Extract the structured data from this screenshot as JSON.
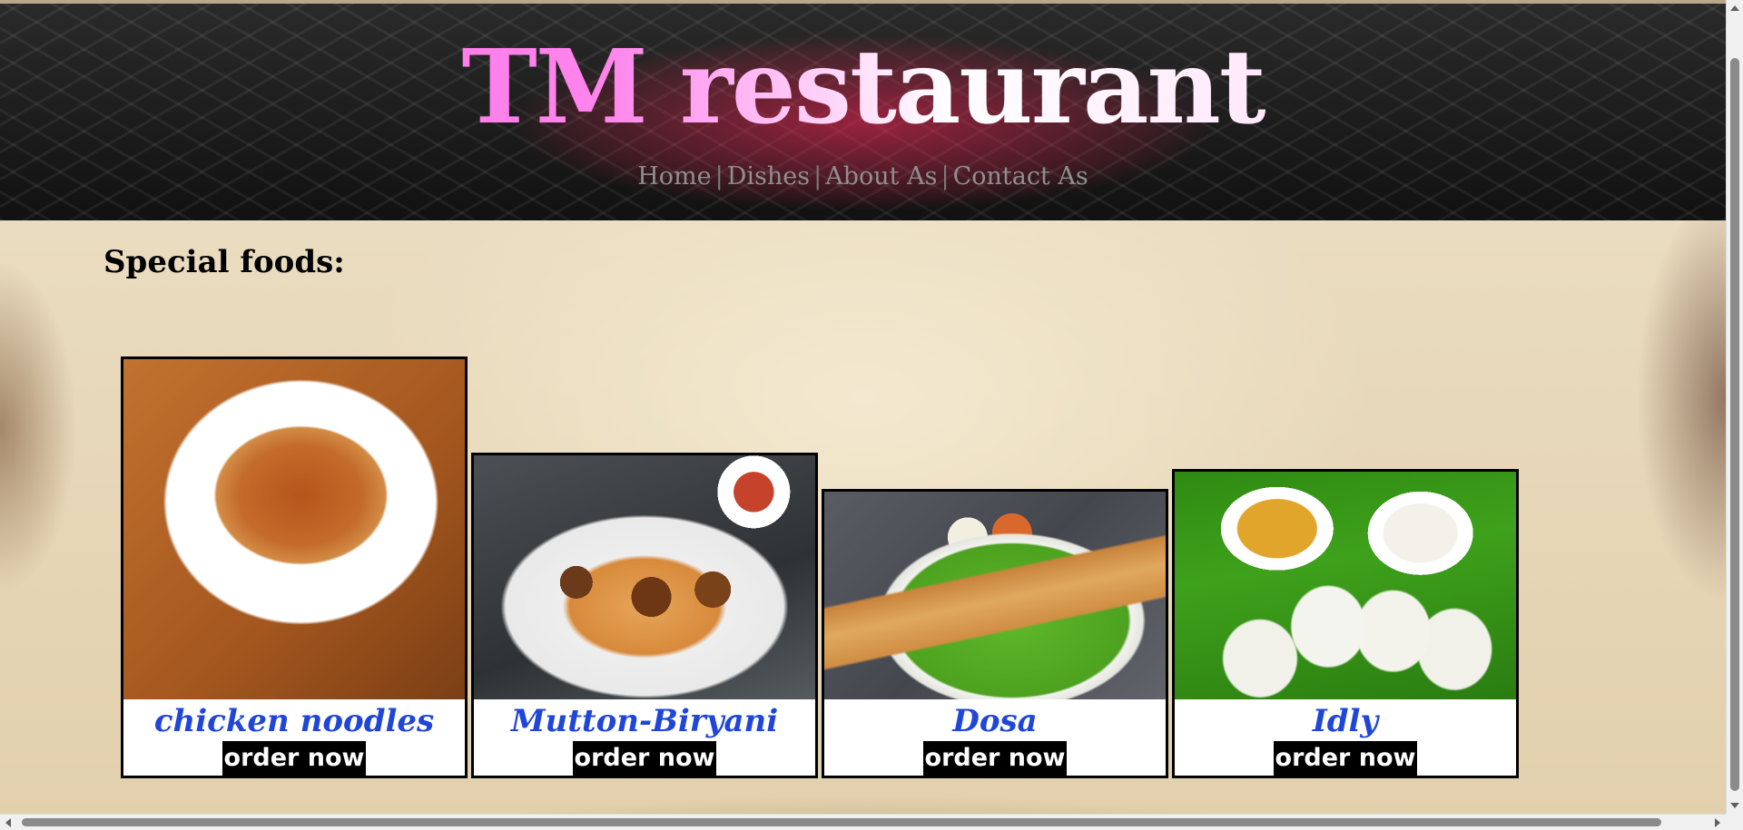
{
  "header": {
    "site_title": "TM restaurant",
    "nav": [
      {
        "label": "Home"
      },
      {
        "label": "Dishes"
      },
      {
        "label": "About As"
      },
      {
        "label": "Contact As"
      }
    ],
    "nav_separator": "|"
  },
  "main": {
    "section_title": "Special foods:",
    "dishes": [
      {
        "name": "chicken noodles",
        "button": "order now",
        "image_icon": "chicken-noodles-photo"
      },
      {
        "name": "Mutton-Biryani",
        "button": "order now",
        "image_icon": "mutton-biryani-photo"
      },
      {
        "name": "Dosa",
        "button": "order now",
        "image_icon": "dosa-photo"
      },
      {
        "name": "Idly",
        "button": "order now",
        "image_icon": "idly-photo"
      }
    ]
  },
  "colors": {
    "title_gradient": [
      "#ff4de0",
      "#ffffff"
    ],
    "dish_name": "#1f46d8",
    "button_bg": "#000000",
    "button_text": "#ffffff",
    "nav_text": "#8f8f8f"
  }
}
